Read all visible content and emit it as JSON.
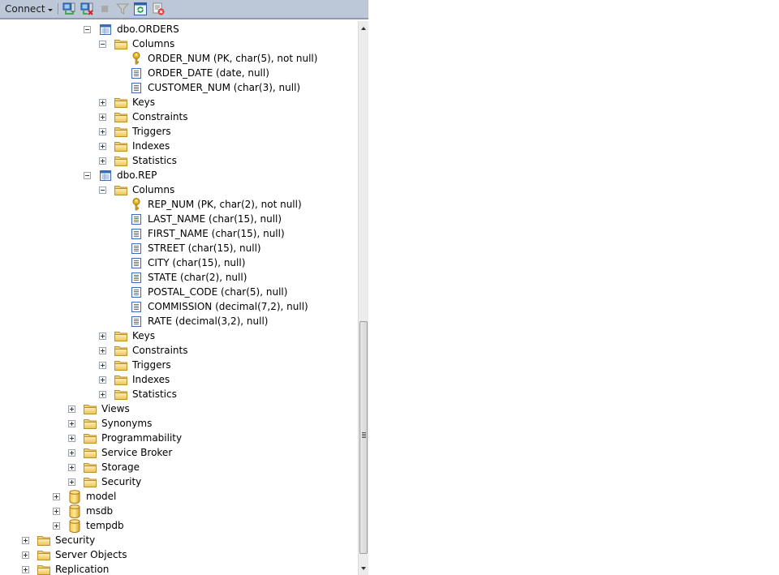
{
  "toolbar": {
    "connect_label": "Connect",
    "buttons": [
      {
        "name": "connect-object-explorer",
        "icon": "server-connect-icon"
      },
      {
        "name": "disconnect",
        "icon": "server-disconnect-icon"
      },
      {
        "name": "stop",
        "icon": "stop-icon"
      },
      {
        "name": "filter",
        "icon": "filter-icon"
      },
      {
        "name": "refresh",
        "icon": "refresh-icon"
      },
      {
        "name": "cancel-script",
        "icon": "script-cancel-icon"
      }
    ]
  },
  "tree": {
    "nodes": [
      {
        "label": "dbo.ORDERS",
        "type": "table",
        "level": 5,
        "expander": "minus"
      },
      {
        "label": "Columns",
        "type": "folder",
        "level": 6,
        "expander": "minus"
      },
      {
        "label": "ORDER_NUM (PK, char(5), not null)",
        "type": "key",
        "level": 7,
        "expander": "none"
      },
      {
        "label": "ORDER_DATE (date, null)",
        "type": "column",
        "level": 7,
        "expander": "none"
      },
      {
        "label": "CUSTOMER_NUM (char(3), null)",
        "type": "column",
        "level": 7,
        "expander": "none"
      },
      {
        "label": "Keys",
        "type": "folder",
        "level": 6,
        "expander": "plus"
      },
      {
        "label": "Constraints",
        "type": "folder",
        "level": 6,
        "expander": "plus"
      },
      {
        "label": "Triggers",
        "type": "folder",
        "level": 6,
        "expander": "plus"
      },
      {
        "label": "Indexes",
        "type": "folder",
        "level": 6,
        "expander": "plus"
      },
      {
        "label": "Statistics",
        "type": "folder",
        "level": 6,
        "expander": "plus"
      },
      {
        "label": "dbo.REP",
        "type": "table",
        "level": 5,
        "expander": "minus"
      },
      {
        "label": "Columns",
        "type": "folder",
        "level": 6,
        "expander": "minus"
      },
      {
        "label": "REP_NUM (PK, char(2), not null)",
        "type": "key",
        "level": 7,
        "expander": "none"
      },
      {
        "label": "LAST_NAME (char(15), null)",
        "type": "column",
        "level": 7,
        "expander": "none"
      },
      {
        "label": "FIRST_NAME (char(15), null)",
        "type": "column",
        "level": 7,
        "expander": "none"
      },
      {
        "label": "STREET (char(15), null)",
        "type": "column",
        "level": 7,
        "expander": "none"
      },
      {
        "label": "CITY (char(15), null)",
        "type": "column",
        "level": 7,
        "expander": "none"
      },
      {
        "label": "STATE (char(2), null)",
        "type": "column",
        "level": 7,
        "expander": "none"
      },
      {
        "label": "POSTAL_CODE (char(5), null)",
        "type": "column",
        "level": 7,
        "expander": "none"
      },
      {
        "label": "COMMISSION (decimal(7,2), null)",
        "type": "column",
        "level": 7,
        "expander": "none"
      },
      {
        "label": "RATE (decimal(3,2), null)",
        "type": "column",
        "level": 7,
        "expander": "none"
      },
      {
        "label": "Keys",
        "type": "folder",
        "level": 6,
        "expander": "plus"
      },
      {
        "label": "Constraints",
        "type": "folder",
        "level": 6,
        "expander": "plus"
      },
      {
        "label": "Triggers",
        "type": "folder",
        "level": 6,
        "expander": "plus"
      },
      {
        "label": "Indexes",
        "type": "folder",
        "level": 6,
        "expander": "plus"
      },
      {
        "label": "Statistics",
        "type": "folder",
        "level": 6,
        "expander": "plus"
      },
      {
        "label": "Views",
        "type": "folder",
        "level": 4,
        "expander": "plus"
      },
      {
        "label": "Synonyms",
        "type": "folder",
        "level": 4,
        "expander": "plus"
      },
      {
        "label": "Programmability",
        "type": "folder",
        "level": 4,
        "expander": "plus"
      },
      {
        "label": "Service Broker",
        "type": "folder",
        "level": 4,
        "expander": "plus"
      },
      {
        "label": "Storage",
        "type": "folder",
        "level": 4,
        "expander": "plus"
      },
      {
        "label": "Security",
        "type": "folder",
        "level": 4,
        "expander": "plus"
      },
      {
        "label": "model",
        "type": "database",
        "level": 3,
        "expander": "plus"
      },
      {
        "label": "msdb",
        "type": "database",
        "level": 3,
        "expander": "plus"
      },
      {
        "label": "tempdb",
        "type": "database",
        "level": 3,
        "expander": "plus"
      },
      {
        "label": "Security",
        "type": "folder",
        "level": 1,
        "expander": "plus"
      },
      {
        "label": "Server Objects",
        "type": "folder",
        "level": 1,
        "expander": "plus"
      },
      {
        "label": "Replication",
        "type": "folder",
        "level": 1,
        "expander": "plus"
      }
    ]
  },
  "scrollbar": {
    "position_fraction": 0.58,
    "visible_fraction": 0.42
  }
}
